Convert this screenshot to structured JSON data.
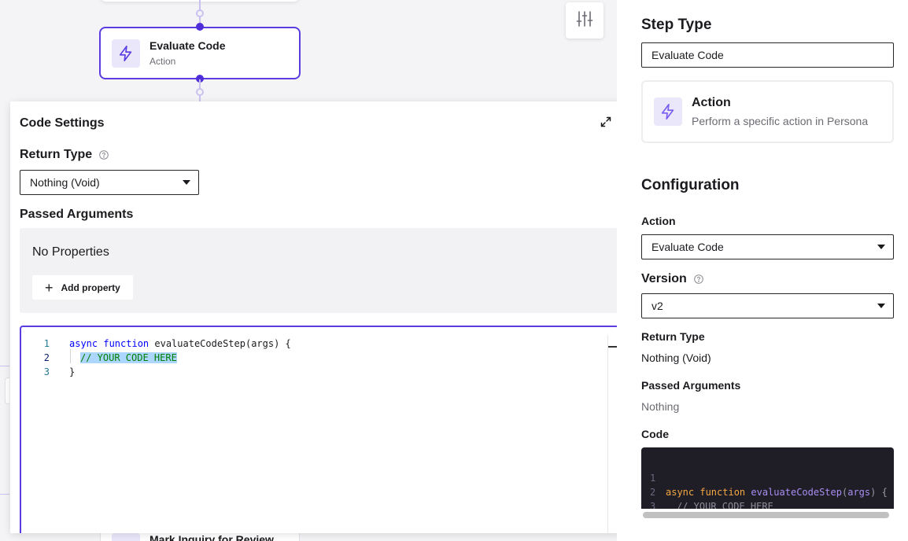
{
  "canvas": {
    "node": {
      "title": "Evaluate Code",
      "subtitle": "Action",
      "icon": "lightning-icon"
    },
    "bottom_node": {
      "title": "Mark Inquiry for Review"
    },
    "settings_icon": "sliders-icon"
  },
  "code_settings": {
    "title": "Code Settings",
    "expand_icon": "expand-icon",
    "return_type_label": "Return Type",
    "return_type_value": "Nothing (Void)",
    "passed_arguments_label": "Passed Arguments",
    "no_properties_text": "No Properties",
    "add_property_label": "Add property",
    "editor_lines": [
      {
        "num": "1",
        "keyword": "async function",
        "rest": " evaluateCodeStep(args) {"
      },
      {
        "num": "2",
        "comment": "// YOUR CODE HERE"
      },
      {
        "num": "3",
        "rest": "}"
      }
    ]
  },
  "sidebar": {
    "step_type_heading": "Step Type",
    "step_type_value": "Evaluate Code",
    "action_card": {
      "title": "Action",
      "description": "Perform a specific action in Persona",
      "icon": "lightning-icon"
    },
    "configuration_heading": "Configuration",
    "action_label": "Action",
    "action_value": "Evaluate Code",
    "version_label": "Version",
    "version_value": "v2",
    "return_type_label": "Return Type",
    "return_type_value": "Nothing (Void)",
    "passed_arguments_label": "Passed Arguments",
    "passed_arguments_value": "Nothing",
    "code_label": "Code",
    "code_preview": {
      "line1": {
        "num": "1",
        "kw": "async function",
        "fn": "evaluateCodeStep",
        "open": "(",
        "arg": "args",
        "close": ") {"
      },
      "line2": {
        "num": "2",
        "comment": "// YOUR CODE HERE"
      },
      "line3": {
        "num": "3",
        "text": "}"
      }
    }
  },
  "colors": {
    "accent": "#5b3ce0",
    "icon_bg": "#ebe7fb",
    "code_bg": "#1f1e26"
  }
}
